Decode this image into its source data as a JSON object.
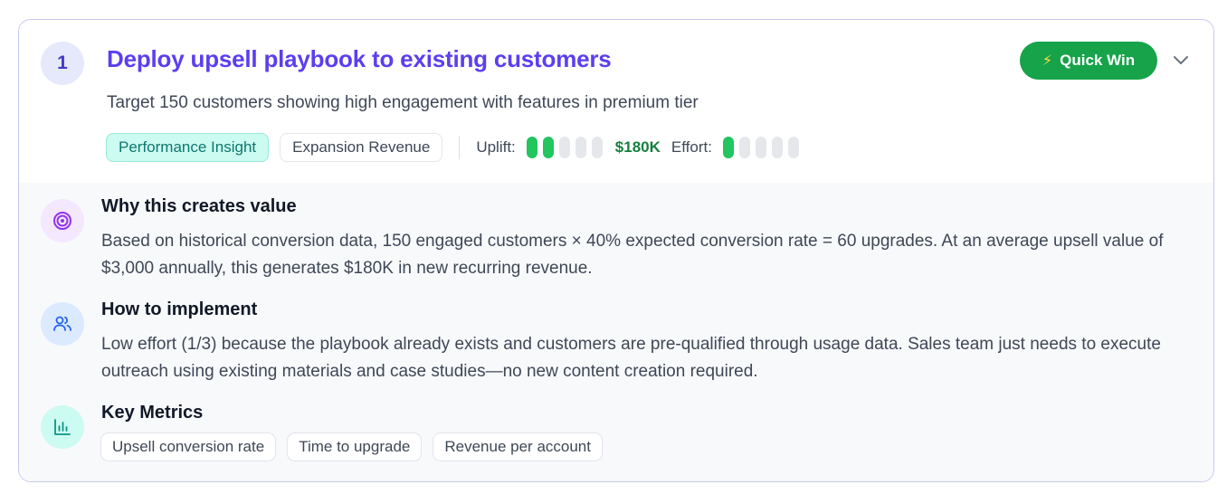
{
  "card": {
    "rank": "1",
    "title": "Deploy upsell playbook to existing customers",
    "badge": {
      "icon": "⚡",
      "label": "Quick Win"
    },
    "subtitle": "Target 150 customers showing high engagement with features in premium tier",
    "tags": [
      "Performance Insight",
      "Expansion Revenue"
    ],
    "uplift": {
      "label": "Uplift:",
      "level": 2,
      "max": 5,
      "value": "$180K"
    },
    "effort": {
      "label": "Effort:",
      "level": 1,
      "max": 5
    }
  },
  "sections": {
    "why": {
      "icon": "target-icon",
      "title": "Why this creates value",
      "body": "Based on historical conversion data, 150 engaged customers × 40% expected conversion rate = 60 upgrades. At an average upsell value of $3,000 annually, this generates $180K in new recurring revenue."
    },
    "how": {
      "icon": "users-icon",
      "title": "How to implement",
      "body": "Low effort (1/3) because the playbook already exists and customers are pre-qualified through usage data. Sales team just needs to execute outreach using existing materials and case studies—no new content creation required."
    },
    "metrics": {
      "icon": "bar-chart-icon",
      "title": "Key Metrics",
      "items": [
        "Upsell conversion rate",
        "Time to upgrade",
        "Revenue per account"
      ]
    }
  },
  "colors": {
    "accent": "#5b3ff0",
    "quick_win": "#16a34a",
    "pill_on": "#22c55e",
    "pill_off": "#e5e7eb"
  }
}
